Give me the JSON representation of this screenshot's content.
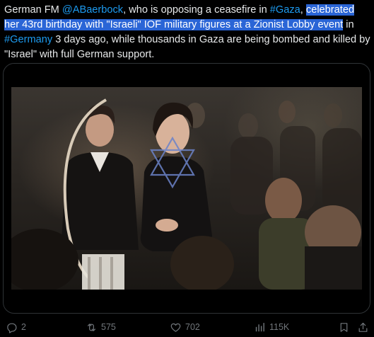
{
  "tweet": {
    "segments": [
      {
        "text": "German FM ",
        "style": "plain"
      },
      {
        "text": "@ABaerbock",
        "style": "mention"
      },
      {
        "text": ", who is opposing a ceasefire in ",
        "style": "plain"
      },
      {
        "text": "#Gaza",
        "style": "hashtag"
      },
      {
        "text": ", ",
        "style": "plain"
      },
      {
        "text": "celebrated her 43rd birthday with \"Israeli\" IOF military figures at a Zionist Lobby event",
        "style": "highlight"
      },
      {
        "text": " in ",
        "style": "plain"
      },
      {
        "text": "#Germany",
        "style": "hashtag"
      },
      {
        "text": " 3 days ago, while thousands in Gaza are being bombed and killed by \"Israel\" with full German support.",
        "style": "plain"
      }
    ]
  },
  "media": {
    "type": "video"
  },
  "actions": {
    "reply_count": "2",
    "repost_count": "575",
    "like_count": "702",
    "views_count": "115K"
  },
  "icons": {
    "reply": "reply-icon",
    "repost": "repost-icon",
    "like": "heart-icon",
    "views": "views-icon",
    "bookmark": "bookmark-icon",
    "share": "share-icon"
  },
  "colors": {
    "background": "#000000",
    "text": "#e7e9ea",
    "link": "#1d9bf0",
    "highlight": "#2a65d6",
    "muted": "#71767b",
    "border": "#2f3336"
  }
}
